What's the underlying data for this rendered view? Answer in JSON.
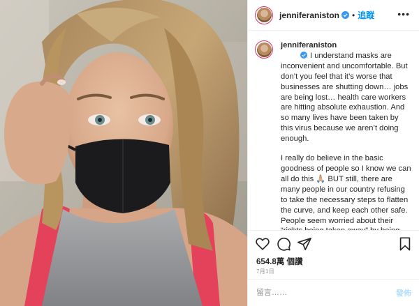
{
  "header": {
    "username": "jenniferaniston",
    "follow_label": "追蹤",
    "separator": "•",
    "more_glyph": "•••"
  },
  "caption": {
    "username": "jenniferaniston",
    "paragraph_1": "I understand masks are inconvenient and uncomfortable. But don’t you feel that it’s worse that businesses are shutting down… jobs are being lost… health care workers are hitting absolute exhaustion. And so many lives have been taken by this virus because we aren’t doing enough.",
    "paragraph_2": "I really do believe in the basic goodness of people so I know we can all do this 🙏🏼 BUT still, there are many people in our country refusing to take the necessary steps to flatten the curve, and keep each other safe. People seem worried about their “rights being taken away” by being asked to wear a mask. This simple and effective recommendation is"
  },
  "actions": {
    "like_icon": "heart-icon",
    "comment_icon": "comment-icon",
    "share_icon": "share-icon",
    "save_icon": "bookmark-icon"
  },
  "likes": "654.8萬 個讚",
  "date": "7月1日",
  "comment_box": {
    "placeholder": "留言……",
    "post_label": "發佈"
  },
  "colors": {
    "accent": "#0095f6",
    "verified": "#3897f0",
    "post_disabled": "#b2dffc",
    "mask": "#1b1b1d",
    "tank_top": "#e3425a"
  }
}
